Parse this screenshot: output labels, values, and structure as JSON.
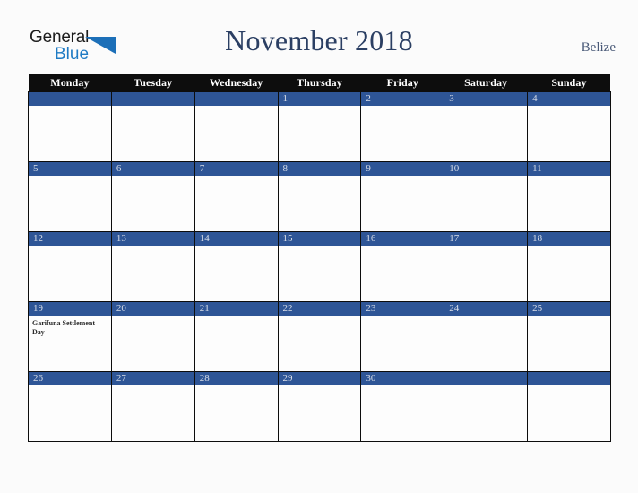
{
  "logo": {
    "word1": "General",
    "word2": "Blue",
    "triangle_color": "#1c6fb8",
    "word1_color": "#1c1c1c",
    "word2_color": "#1f7bc4"
  },
  "header": {
    "title": "November 2018",
    "country": "Belize",
    "title_color": "#2b3f63",
    "country_color": "#4a5a78"
  },
  "theme": {
    "background": "#fbfbfb",
    "header_row_bg": "#0d0d0d",
    "header_row_text": "#ffffff",
    "datebar_bg": "#2e5596",
    "datebar_text": "#d9dee8",
    "cell_bg": "#fdfdfd",
    "grid_line": "#0d0d0d",
    "event_text": "#2b2b2b"
  },
  "calendar": {
    "weekday_headers": [
      "Monday",
      "Tuesday",
      "Wednesday",
      "Thursday",
      "Friday",
      "Saturday",
      "Sunday"
    ],
    "weeks": [
      [
        {
          "date": "",
          "events": []
        },
        {
          "date": "",
          "events": []
        },
        {
          "date": "",
          "events": []
        },
        {
          "date": "1",
          "events": []
        },
        {
          "date": "2",
          "events": []
        },
        {
          "date": "3",
          "events": []
        },
        {
          "date": "4",
          "events": []
        }
      ],
      [
        {
          "date": "5",
          "events": []
        },
        {
          "date": "6",
          "events": []
        },
        {
          "date": "7",
          "events": []
        },
        {
          "date": "8",
          "events": []
        },
        {
          "date": "9",
          "events": []
        },
        {
          "date": "10",
          "events": []
        },
        {
          "date": "11",
          "events": []
        }
      ],
      [
        {
          "date": "12",
          "events": []
        },
        {
          "date": "13",
          "events": []
        },
        {
          "date": "14",
          "events": []
        },
        {
          "date": "15",
          "events": []
        },
        {
          "date": "16",
          "events": []
        },
        {
          "date": "17",
          "events": []
        },
        {
          "date": "18",
          "events": []
        }
      ],
      [
        {
          "date": "19",
          "events": [
            "Garifuna Settlement Day"
          ]
        },
        {
          "date": "20",
          "events": []
        },
        {
          "date": "21",
          "events": []
        },
        {
          "date": "22",
          "events": []
        },
        {
          "date": "23",
          "events": []
        },
        {
          "date": "24",
          "events": []
        },
        {
          "date": "25",
          "events": []
        }
      ],
      [
        {
          "date": "26",
          "events": []
        },
        {
          "date": "27",
          "events": []
        },
        {
          "date": "28",
          "events": []
        },
        {
          "date": "29",
          "events": []
        },
        {
          "date": "30",
          "events": []
        },
        {
          "date": "",
          "events": []
        },
        {
          "date": "",
          "events": []
        }
      ]
    ]
  }
}
